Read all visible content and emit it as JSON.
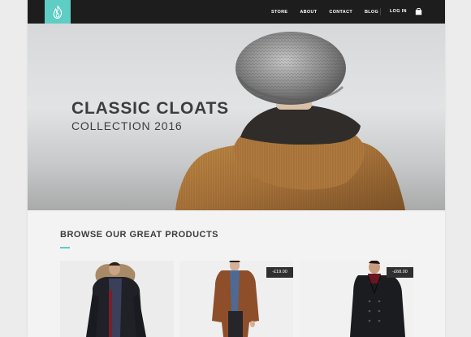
{
  "nav": {
    "links": [
      "STORE",
      "ABOUT",
      "CONTACT",
      "BLOG"
    ],
    "login": "LOG IN"
  },
  "hero": {
    "title": "CLASSIC CLOATS",
    "subtitle": "COLLECTION 2016"
  },
  "section": {
    "title": "BROWSE OUR GREAT PRODUCTS"
  },
  "products": [
    {
      "price": ""
    },
    {
      "price": "-£19.00"
    },
    {
      "price": "-£68.00"
    }
  ],
  "colors": {
    "accent": "#5ecdc4",
    "nav_bg": "#1d1d1d",
    "text": "#3d3d3d"
  }
}
